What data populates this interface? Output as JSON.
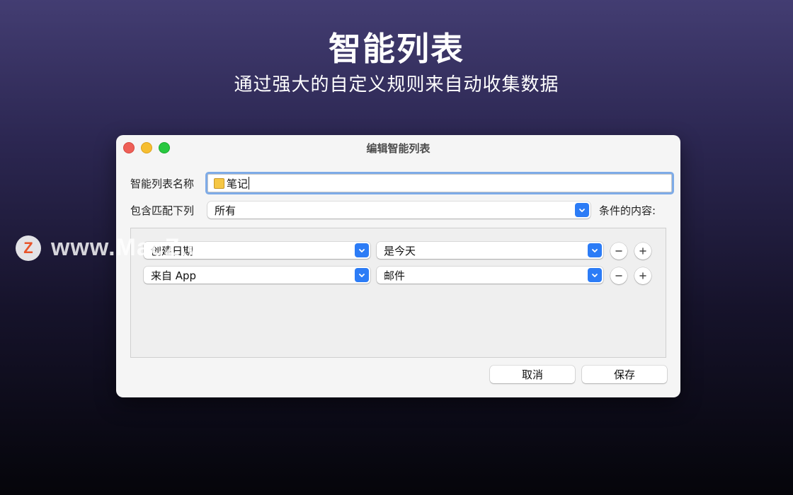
{
  "hero": {
    "title": "智能列表",
    "subtitle": "通过强大的自定义规则来自动收集数据"
  },
  "watermark": {
    "logo_letter": "Z",
    "text": "www.MacZ.com"
  },
  "dialog": {
    "title": "编辑智能列表",
    "name_label": "智能列表名称",
    "name_value": "笔记",
    "name_icon": "folder-icon",
    "match_label": "包含匹配下列",
    "match_selected": "所有",
    "match_suffix": "条件的内容:",
    "rules": [
      {
        "field": "创建日期",
        "condition": "是今天"
      },
      {
        "field": "来自 App",
        "condition": "邮件"
      }
    ],
    "cancel_label": "取消",
    "save_label": "保存"
  },
  "colors": {
    "accent": "#2c7cf6",
    "close": "#ee5f57",
    "minimize": "#f6be31",
    "maximize": "#28c840",
    "focus_ring": "#7eabe7"
  }
}
